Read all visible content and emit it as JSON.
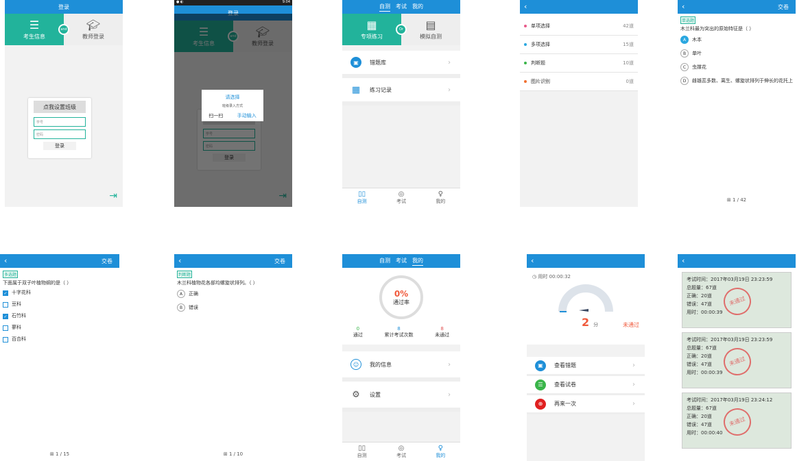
{
  "s1": {
    "title": "登录",
    "tab_left": "考生信息",
    "tab_right": "教师登录",
    "badge": "and",
    "set_class": "点我设置班级",
    "student_id_ph": "学号",
    "password_ph": "密码",
    "login": "登录"
  },
  "s2": {
    "status_time": "9:04",
    "dialog_title": "请选择",
    "dialog_sub": "班级录入方式",
    "scan": "扫一扫",
    "manual": "手动输入"
  },
  "s3": {
    "tabs": [
      "自测",
      "考试",
      "我的"
    ],
    "hero_left": "专项练习",
    "hero_right": "模拟自测",
    "hero_badge": "Or",
    "rows": [
      "错题库",
      "练习记录"
    ],
    "nav": [
      "自测",
      "考试",
      "我的"
    ]
  },
  "s4": {
    "cats": [
      {
        "name": "单项选择",
        "count": "42道",
        "color": "#e85a8a"
      },
      {
        "name": "多项选择",
        "count": "15道",
        "color": "#2aa7e0"
      },
      {
        "name": "判断题",
        "count": "10道",
        "color": "#3ab54a"
      },
      {
        "name": "图片识别",
        "count": "0道",
        "color": "#f07030"
      }
    ]
  },
  "s5": {
    "submit": "交卷",
    "tag": "单选题",
    "question": "木兰科最为突出的原始特征是（ ）",
    "options": [
      {
        "k": "A",
        "t": "木本"
      },
      {
        "k": "B",
        "t": "单叶"
      },
      {
        "k": "C",
        "t": "虫媒花"
      },
      {
        "k": "D",
        "t": "雌雄蕊多数、离生、螺旋状排列于伸长的花托上"
      }
    ],
    "pager": "1 / 42"
  },
  "s6": {
    "submit": "交卷",
    "tag": "多选题",
    "question": "下面属于双子叶植物纲的是（ ）",
    "options": [
      "十字花科",
      "豆科",
      "石竹科",
      "蓼科",
      "百合科"
    ],
    "pager": "1 / 15"
  },
  "s7": {
    "submit": "交卷",
    "tag": "判断题",
    "question": "木兰科植物花各部均螺旋状排列。（ ）",
    "options": [
      {
        "k": "A",
        "t": "正确"
      },
      {
        "k": "B",
        "t": "错误"
      }
    ],
    "pager": "1 / 10"
  },
  "s8": {
    "tabs": [
      "自测",
      "考试",
      "我的"
    ],
    "percent": "0%",
    "pass_rate": "通过率",
    "stats": [
      {
        "v": "0",
        "l": "通过",
        "c": "#3ab54a"
      },
      {
        "v": "8",
        "l": "累计考试次数",
        "c": "#1e8fd8"
      },
      {
        "v": "8",
        "l": "未通过",
        "c": "#e05050"
      }
    ],
    "rows": [
      "我的信息",
      "设置"
    ],
    "nav": [
      "自测",
      "考试",
      "我的"
    ]
  },
  "s9": {
    "time": "用时 00:00:32",
    "score": "2",
    "unit": "分",
    "result": "未通过",
    "rows": [
      "查看错题",
      "查看试卷",
      "再来一次"
    ]
  },
  "s10": {
    "exams": [
      {
        "time": "考试时间：2017年03月19日 23:23:59",
        "total": "总题量：67道",
        "right": "正确：20道",
        "wrong": "错误：47道",
        "used": "用时：00:00:39"
      },
      {
        "time": "考试时间：2017年03月19日 23:23:59",
        "total": "总题量：67道",
        "right": "正确：20道",
        "wrong": "错误：47道",
        "used": "用时：00:00:39"
      },
      {
        "time": "考试时间：2017年03月19日 23:24:12",
        "total": "总题量：67道",
        "right": "正确：20道",
        "wrong": "错误：47道",
        "used": "用时：00:00:40"
      }
    ],
    "stamp": "未通过"
  }
}
